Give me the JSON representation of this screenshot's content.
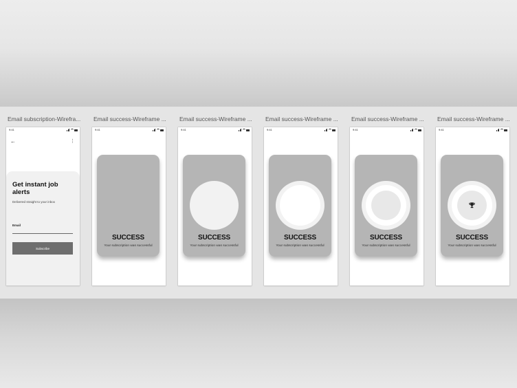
{
  "status_bar": {
    "time": "9:41"
  },
  "frames": [
    {
      "title": "Email subscription-Wirefra..."
    },
    {
      "title": "Email success-Wireframe ..."
    },
    {
      "title": "Email success-Wireframe ..."
    },
    {
      "title": "Email success-Wireframe ..."
    },
    {
      "title": "Email success-Wireframe ..."
    },
    {
      "title": "Email success-Wireframe ..."
    }
  ],
  "subscription": {
    "back_icon": "arrow-left-icon",
    "more_icon": "more-vertical-icon",
    "title": "Get instant job alerts",
    "subtitle": "Delivered straight to your inbox",
    "email_label": "Email",
    "email_value": "",
    "subscribe_label": "Subscribe"
  },
  "success": {
    "heading": "SUCCESS",
    "message": "Your subscription was successful",
    "trophy_icon": "trophy-icon"
  },
  "colors": {
    "canvas": "#e5e5e5",
    "card": "#b5b5b5",
    "button": "#6e6e6e"
  }
}
